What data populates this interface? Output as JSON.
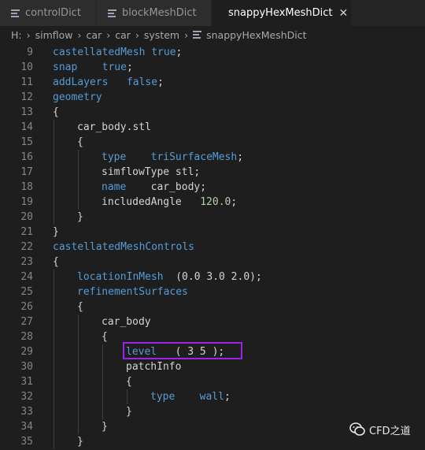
{
  "tabs": [
    {
      "label": "controlDict",
      "active": false
    },
    {
      "label": "blockMeshDict",
      "active": false
    },
    {
      "label": "snappyHexMeshDict",
      "active": true,
      "close": "✕"
    }
  ],
  "breadcrumb": [
    "H:",
    "simflow",
    "car",
    "car",
    "system",
    "snappyHexMeshDict"
  ],
  "code_lines": [
    {
      "n": "9",
      "indent": 0,
      "tokens": [
        {
          "t": "castellatedMesh",
          "c": "kw"
        },
        {
          "t": " ",
          "c": "id"
        },
        {
          "t": "true",
          "c": "kw"
        },
        {
          "t": ";",
          "c": "id"
        }
      ]
    },
    {
      "n": "10",
      "indent": 0,
      "tokens": [
        {
          "t": "snap",
          "c": "kw"
        },
        {
          "t": "    ",
          "c": "id"
        },
        {
          "t": "true",
          "c": "kw"
        },
        {
          "t": ";",
          "c": "id"
        }
      ]
    },
    {
      "n": "11",
      "indent": 0,
      "tokens": [
        {
          "t": "addLayers",
          "c": "kw"
        },
        {
          "t": "   ",
          "c": "id"
        },
        {
          "t": "false",
          "c": "kw"
        },
        {
          "t": ";",
          "c": "id"
        }
      ]
    },
    {
      "n": "12",
      "indent": 0,
      "tokens": [
        {
          "t": "geometry",
          "c": "kw"
        }
      ]
    },
    {
      "n": "13",
      "indent": 0,
      "tokens": [
        {
          "t": "{",
          "c": "id"
        }
      ]
    },
    {
      "n": "14",
      "indent": 1,
      "tokens": [
        {
          "t": "car_body.stl",
          "c": "id"
        }
      ]
    },
    {
      "n": "15",
      "indent": 1,
      "tokens": [
        {
          "t": "{",
          "c": "id"
        }
      ]
    },
    {
      "n": "16",
      "indent": 2,
      "tokens": [
        {
          "t": "type",
          "c": "kw"
        },
        {
          "t": "    ",
          "c": "id"
        },
        {
          "t": "triSurfaceMesh",
          "c": "kw"
        },
        {
          "t": ";",
          "c": "id"
        }
      ]
    },
    {
      "n": "17",
      "indent": 2,
      "tokens": [
        {
          "t": "simflowType stl;",
          "c": "id"
        }
      ]
    },
    {
      "n": "18",
      "indent": 2,
      "tokens": [
        {
          "t": "name",
          "c": "kw"
        },
        {
          "t": "    car_body;",
          "c": "id"
        }
      ]
    },
    {
      "n": "19",
      "indent": 2,
      "tokens": [
        {
          "t": "includedAngle   ",
          "c": "id"
        },
        {
          "t": "120.0",
          "c": "num"
        },
        {
          "t": ";",
          "c": "id"
        }
      ]
    },
    {
      "n": "20",
      "indent": 1,
      "tokens": [
        {
          "t": "}",
          "c": "id"
        }
      ]
    },
    {
      "n": "21",
      "indent": 0,
      "tokens": [
        {
          "t": "}",
          "c": "id"
        }
      ]
    },
    {
      "n": "22",
      "indent": 0,
      "tokens": [
        {
          "t": "castellatedMeshControls",
          "c": "kw"
        }
      ]
    },
    {
      "n": "23",
      "indent": 0,
      "tokens": [
        {
          "t": "{",
          "c": "id"
        }
      ]
    },
    {
      "n": "24",
      "indent": 1,
      "tokens": [
        {
          "t": "locationInMesh",
          "c": "kw"
        },
        {
          "t": "  (0.0 3.0 2.0);",
          "c": "id"
        }
      ]
    },
    {
      "n": "25",
      "indent": 1,
      "tokens": [
        {
          "t": "refinementSurfaces",
          "c": "kw"
        }
      ]
    },
    {
      "n": "26",
      "indent": 1,
      "tokens": [
        {
          "t": "{",
          "c": "id"
        }
      ]
    },
    {
      "n": "27",
      "indent": 2,
      "tokens": [
        {
          "t": "car_body",
          "c": "id"
        }
      ]
    },
    {
      "n": "28",
      "indent": 2,
      "tokens": [
        {
          "t": "{",
          "c": "id"
        }
      ]
    },
    {
      "n": "29",
      "indent": 3,
      "tokens": [
        {
          "t": "level",
          "c": "kw"
        },
        {
          "t": "   ( 3 5 );",
          "c": "id"
        }
      ]
    },
    {
      "n": "30",
      "indent": 3,
      "tokens": [
        {
          "t": "patchInfo",
          "c": "id"
        }
      ]
    },
    {
      "n": "31",
      "indent": 3,
      "tokens": [
        {
          "t": "{",
          "c": "id"
        }
      ]
    },
    {
      "n": "32",
      "indent": 4,
      "tokens": [
        {
          "t": "type",
          "c": "kw"
        },
        {
          "t": "    ",
          "c": "id"
        },
        {
          "t": "wall",
          "c": "kw"
        },
        {
          "t": ";",
          "c": "id"
        }
      ]
    },
    {
      "n": "33",
      "indent": 3,
      "tokens": [
        {
          "t": "}",
          "c": "id"
        }
      ]
    },
    {
      "n": "34",
      "indent": 2,
      "tokens": [
        {
          "t": "}",
          "c": "id"
        }
      ]
    },
    {
      "n": "35",
      "indent": 1,
      "tokens": [
        {
          "t": "}",
          "c": "id"
        }
      ]
    }
  ],
  "watermark": {
    "text": "CFD之道",
    "icon": "wechat-icon"
  },
  "colors": {
    "keyword": "#569cd6",
    "identifier": "#d4d4d4",
    "number": "#b5cea8",
    "highlight_box": "#a020f0",
    "background": "#1e1e1e"
  }
}
